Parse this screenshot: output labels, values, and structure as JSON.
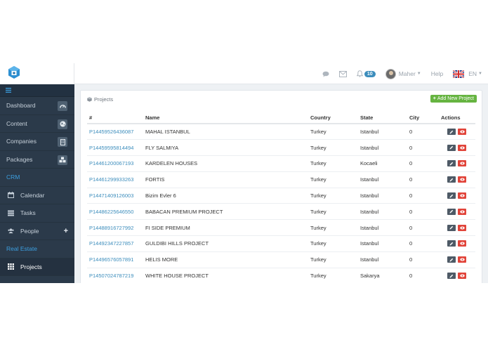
{
  "header": {
    "notification_count": "10",
    "user_name": "Maher",
    "help_label": "Help",
    "language": "EN"
  },
  "sidebar": {
    "items": [
      {
        "label": "Dashboard",
        "icon": "dashboard-icon"
      },
      {
        "label": "Content",
        "icon": "globe-icon"
      },
      {
        "label": "Companies",
        "icon": "building-icon"
      },
      {
        "label": "Packages",
        "icon": "cubes-icon"
      }
    ],
    "crm_section": "CRM",
    "crm_items": [
      {
        "label": "Calendar",
        "icon": "calendar-icon"
      },
      {
        "label": "Tasks",
        "icon": "tasks-icon"
      },
      {
        "label": "People",
        "icon": "users-icon"
      }
    ],
    "realestate_section": "Real Estate",
    "realestate_items": [
      {
        "label": "Projects",
        "icon": "grid-icon"
      }
    ]
  },
  "panel": {
    "title": "Projects",
    "add_button": "Add New Project"
  },
  "table": {
    "columns": [
      "#",
      "Name",
      "Country",
      "State",
      "City",
      "Actions"
    ],
    "rows": [
      {
        "id": "P14459526436087",
        "name": "MAHAL ISTANBUL",
        "country": "Turkey",
        "state": "Istanbul",
        "city": "0"
      },
      {
        "id": "P14459595814494",
        "name": "FLY SALMIYA",
        "country": "Turkey",
        "state": "Istanbul",
        "city": "0"
      },
      {
        "id": "P14461200067193",
        "name": "KARDELEN HOUSES",
        "country": "Turkey",
        "state": "Kocaeli",
        "city": "0"
      },
      {
        "id": "P14461299933263",
        "name": "FORTIS",
        "country": "Turkey",
        "state": "Istanbul",
        "city": "0"
      },
      {
        "id": "P14471409126003",
        "name": "Bizim Evler 6",
        "country": "Turkey",
        "state": "Istanbul",
        "city": "0"
      },
      {
        "id": "P14486225646550",
        "name": "BABACAN PREMIUM PROJECT",
        "country": "Turkey",
        "state": "Istanbul",
        "city": "0"
      },
      {
        "id": "P14488916727992",
        "name": "FI SIDE PREMIUM",
        "country": "Turkey",
        "state": "Istanbul",
        "city": "0"
      },
      {
        "id": "P14492347227857",
        "name": "GULDIBI HILLS PROJECT",
        "country": "Turkey",
        "state": "Istanbul",
        "city": "0"
      },
      {
        "id": "P14496576057891",
        "name": "HELIS MORE",
        "country": "Turkey",
        "state": "Istanbul",
        "city": "0"
      },
      {
        "id": "P14507024787219",
        "name": "WHITE HOUSE PROJECT",
        "country": "Turkey",
        "state": "Sakarya",
        "city": "0"
      }
    ]
  },
  "colors": {
    "sidebar_bg": "#2b3a4a",
    "accent_blue": "#3c8dbc",
    "add_green": "#66b441",
    "view_red": "#e1443a"
  }
}
